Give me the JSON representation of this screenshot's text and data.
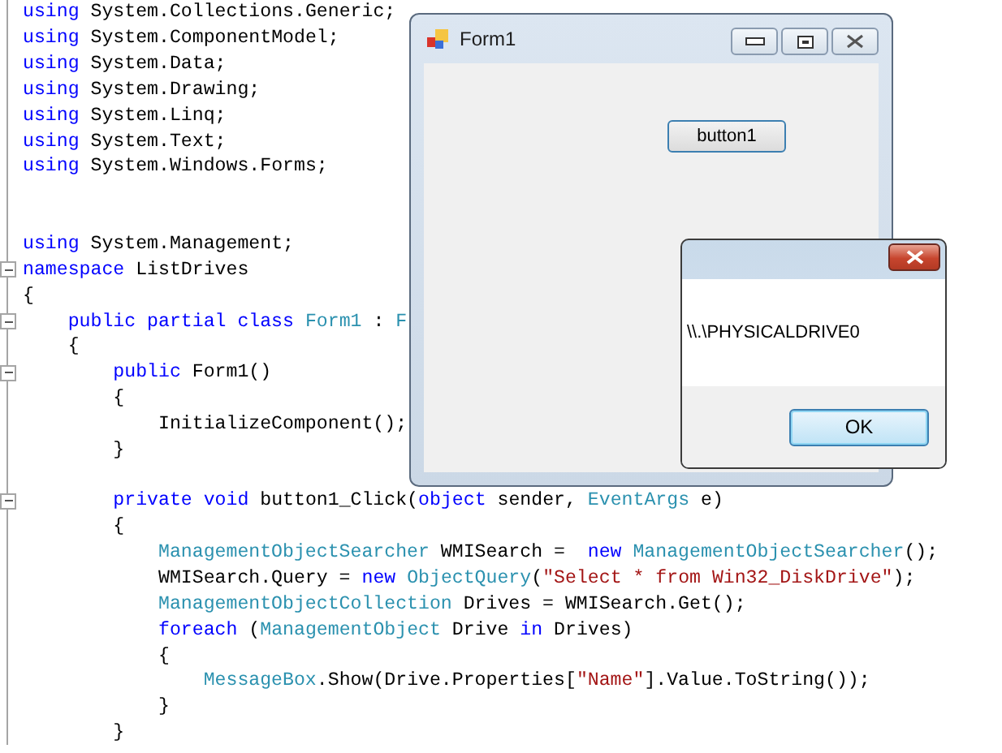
{
  "editor": {
    "lines": [
      {
        "tokens": [
          {
            "text": "using",
            "kind": "keyword"
          },
          {
            "text": " System.Collections.Generic;",
            "kind": "plain"
          }
        ]
      },
      {
        "tokens": [
          {
            "text": "using",
            "kind": "keyword"
          },
          {
            "text": " System.ComponentModel;",
            "kind": "plain"
          }
        ]
      },
      {
        "tokens": [
          {
            "text": "using",
            "kind": "keyword"
          },
          {
            "text": " System.Data;",
            "kind": "plain"
          }
        ]
      },
      {
        "tokens": [
          {
            "text": "using",
            "kind": "keyword"
          },
          {
            "text": " System.Drawing;",
            "kind": "plain"
          }
        ]
      },
      {
        "tokens": [
          {
            "text": "using",
            "kind": "keyword"
          },
          {
            "text": " System.Linq;",
            "kind": "plain"
          }
        ]
      },
      {
        "tokens": [
          {
            "text": "using",
            "kind": "keyword"
          },
          {
            "text": " System.Text;",
            "kind": "plain"
          }
        ]
      },
      {
        "tokens": [
          {
            "text": "using",
            "kind": "keyword"
          },
          {
            "text": " System.Windows.Forms;",
            "kind": "plain"
          }
        ]
      },
      {
        "gap_before": true,
        "wide_gap": true,
        "tokens": [
          {
            "text": "using",
            "kind": "keyword"
          },
          {
            "text": " System.Management;",
            "kind": "plain"
          }
        ]
      },
      {
        "fold": true,
        "tokens": [
          {
            "text": "namespace",
            "kind": "keyword"
          },
          {
            "text": " ListDrives",
            "kind": "plain"
          }
        ]
      },
      {
        "tokens": [
          {
            "text": "{",
            "kind": "plain"
          }
        ]
      },
      {
        "fold": true,
        "tokens": [
          {
            "text": "    public partial class",
            "kind": "keyword"
          },
          {
            "text": " Form1",
            "kind": "type"
          },
          {
            "text": " : ",
            "kind": "plain"
          },
          {
            "text": "F",
            "kind": "type"
          }
        ]
      },
      {
        "tokens": [
          {
            "text": "    {",
            "kind": "plain"
          }
        ]
      },
      {
        "fold": true,
        "tokens": [
          {
            "text": "        public",
            "kind": "keyword"
          },
          {
            "text": " Form1()",
            "kind": "plain"
          }
        ]
      },
      {
        "tokens": [
          {
            "text": "        {",
            "kind": "plain"
          }
        ]
      },
      {
        "tokens": [
          {
            "text": "            InitializeComponent();",
            "kind": "plain"
          }
        ]
      },
      {
        "tokens": [
          {
            "text": "        }",
            "kind": "plain"
          }
        ]
      },
      {
        "gap_before": true,
        "wide_gap": false,
        "fold": true,
        "tokens": [
          {
            "text": "        private void",
            "kind": "keyword"
          },
          {
            "text": " button1_Click(",
            "kind": "plain"
          },
          {
            "text": "object",
            "kind": "keyword"
          },
          {
            "text": " sender, ",
            "kind": "plain"
          },
          {
            "text": "EventArgs",
            "kind": "type"
          },
          {
            "text": " e)",
            "kind": "plain"
          }
        ]
      },
      {
        "tokens": [
          {
            "text": "        {",
            "kind": "plain"
          }
        ]
      },
      {
        "tokens": [
          {
            "text": "            ManagementObjectSearcher",
            "kind": "type"
          },
          {
            "text": " WMISearch =  ",
            "kind": "plain"
          },
          {
            "text": "new",
            "kind": "keyword"
          },
          {
            "text": " ManagementObjectSearcher",
            "kind": "type"
          },
          {
            "text": "();",
            "kind": "plain"
          }
        ]
      },
      {
        "tokens": [
          {
            "text": "            WMISearch.Query = ",
            "kind": "plain"
          },
          {
            "text": "new",
            "kind": "keyword"
          },
          {
            "text": " ObjectQuery",
            "kind": "type"
          },
          {
            "text": "(",
            "kind": "plain"
          },
          {
            "text": "\"Select * from Win32_DiskDrive\"",
            "kind": "string"
          },
          {
            "text": ");",
            "kind": "plain"
          }
        ]
      },
      {
        "tokens": [
          {
            "text": "            ManagementObjectCollection",
            "kind": "type"
          },
          {
            "text": " Drives = WMISearch.Get();",
            "kind": "plain"
          }
        ]
      },
      {
        "tokens": [
          {
            "text": "            foreach",
            "kind": "keyword"
          },
          {
            "text": " (",
            "kind": "plain"
          },
          {
            "text": "ManagementObject",
            "kind": "type"
          },
          {
            "text": " Drive ",
            "kind": "plain"
          },
          {
            "text": "in",
            "kind": "keyword"
          },
          {
            "text": " Drives)",
            "kind": "plain"
          }
        ]
      },
      {
        "tokens": [
          {
            "text": "            {",
            "kind": "plain"
          }
        ]
      },
      {
        "tokens": [
          {
            "text": "                MessageBox",
            "kind": "type"
          },
          {
            "text": ".Show(Drive.Properties[",
            "kind": "plain"
          },
          {
            "text": "\"Name\"",
            "kind": "string"
          },
          {
            "text": "].Value.ToString());",
            "kind": "plain"
          }
        ]
      },
      {
        "tokens": [
          {
            "text": "            }",
            "kind": "plain"
          }
        ]
      },
      {
        "tokens": [
          {
            "text": "        }",
            "kind": "plain"
          }
        ]
      }
    ]
  },
  "form_window": {
    "title": "Form1",
    "button": "button1"
  },
  "message_box": {
    "text": "\\\\.\\PHYSICALDRIVE0",
    "button": "OK"
  }
}
